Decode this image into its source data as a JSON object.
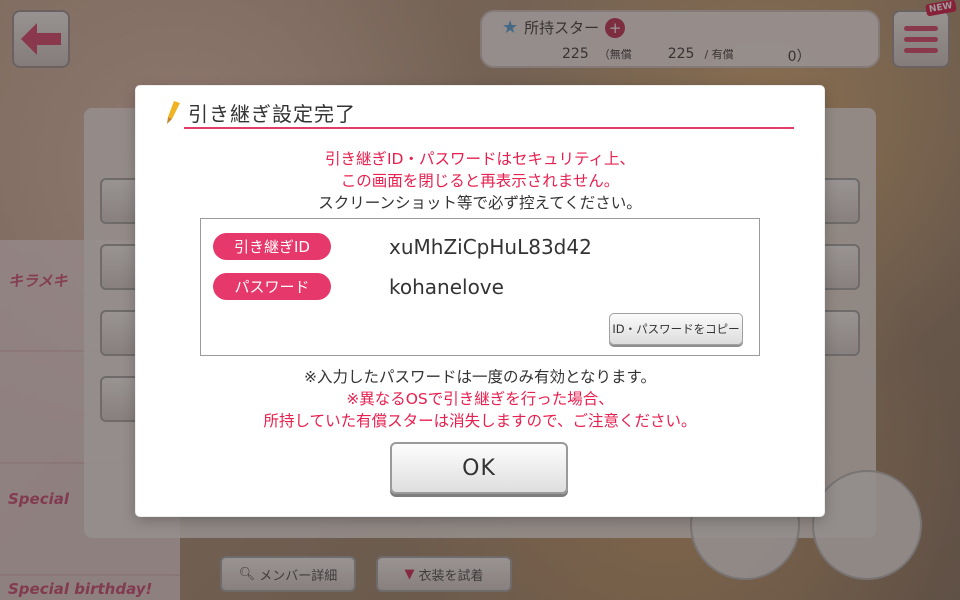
{
  "header": {
    "stars_label": "所持スター",
    "stars_total": "225",
    "free_label": "（無償",
    "free_value": "225",
    "paid_label": "/ 有償",
    "paid_value": "0）",
    "new_badge": "NEW"
  },
  "dialog": {
    "title": "引き継ぎ設定完了",
    "warning_line1": "引き継ぎID・パスワードはセキュリティ上、",
    "warning_line2": "この画面を閉じると再表示されません。",
    "instruction": "スクリーンショット等で必ず控えてください。",
    "id_label": "引き継ぎID",
    "id_value": "xuMhZiCpHuL83d42",
    "password_label": "パスワード",
    "password_value": "kohanelove",
    "copy_button": "ID・パスワードをコピー",
    "note": "※入力したパスワードは一度のみ有効となります。",
    "os_warning_line1": "※異なるOSで引き継ぎを行った場合、",
    "os_warning_line2": "所持していた有償スターは消失しますので、ご注意ください。",
    "ok_button": "OK"
  },
  "background": {
    "member_detail_button": "メンバー詳細",
    "try_costume_button": "衣装を試着",
    "banner_special": "Special",
    "banner_birthday": "Special birthday!",
    "banner_kirameki": "キラメキ"
  },
  "colors": {
    "accent_pink": "#e6386a",
    "warning_red": "#e8204f",
    "rule_pink": "#e23c68"
  },
  "icons": [
    "back-arrow-icon",
    "menu-icon",
    "star-icon",
    "plus-icon",
    "pencil-icon",
    "search-icon",
    "shirt-icon"
  ]
}
